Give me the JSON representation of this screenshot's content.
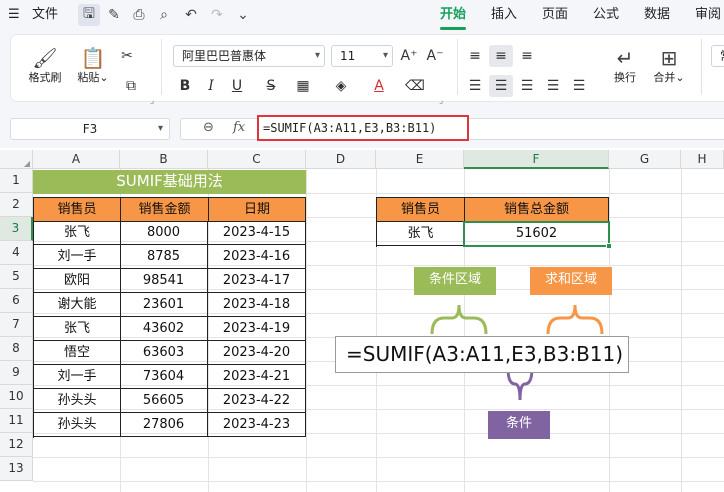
{
  "menubar": {
    "menu_icon": "hamburger-icon",
    "file_label": "文件",
    "tabs": [
      "开始",
      "插入",
      "页面",
      "公式",
      "数据",
      "审阅"
    ],
    "active_tab": "开始"
  },
  "ribbon": {
    "format_painter": "格式刷",
    "paste": "粘贴",
    "font_name": "阿里巴巴普惠体",
    "font_size": "11",
    "wrap_text": "换行",
    "merge": "合并",
    "overflow_label": "常"
  },
  "formula_bar": {
    "name_box": "F3",
    "fx_label": "fx",
    "formula": "=SUMIF(A3:A11,E3,B3:B11)"
  },
  "columns": [
    "A",
    "B",
    "C",
    "D",
    "E",
    "F",
    "G",
    "H"
  ],
  "rows": [
    "1",
    "2",
    "3",
    "4",
    "5",
    "6",
    "7",
    "8",
    "9",
    "10",
    "11",
    "12",
    "13"
  ],
  "sheet": {
    "title": "SUMIF基础用法",
    "headers": [
      "销售员",
      "销售金额",
      "日期"
    ],
    "data": [
      [
        "张飞",
        "8000",
        "2023-4-15"
      ],
      [
        "刘一手",
        "8785",
        "2023-4-16"
      ],
      [
        "欧阳",
        "98541",
        "2023-4-17"
      ],
      [
        "谢大能",
        "23601",
        "2023-4-18"
      ],
      [
        "张飞",
        "43602",
        "2023-4-19"
      ],
      [
        "悟空",
        "63603",
        "2023-4-20"
      ],
      [
        "刘一手",
        "73604",
        "2023-4-21"
      ],
      [
        "孙头头",
        "56605",
        "2023-4-22"
      ],
      [
        "孙头头",
        "27806",
        "2023-4-23"
      ]
    ],
    "lookup_headers": [
      "销售员",
      "销售总金额"
    ],
    "lookup_row": [
      "张飞",
      "51602"
    ]
  },
  "diagram": {
    "condition_range_label": "条件区域",
    "sum_range_label": "求和区域",
    "condition_label": "条件",
    "formula_display": "=SUMIF(A3:A11,E3,B3:B11)"
  },
  "colors": {
    "title_fill": "#9bbb59",
    "header_fill": "#f79646",
    "selected_border": "#2f8f4e",
    "accent": "#16a05a",
    "tag_green": "#9bbb59",
    "tag_orange": "#f79646",
    "tag_purple": "#8064a2",
    "formula_highlight": "#e0353b"
  }
}
